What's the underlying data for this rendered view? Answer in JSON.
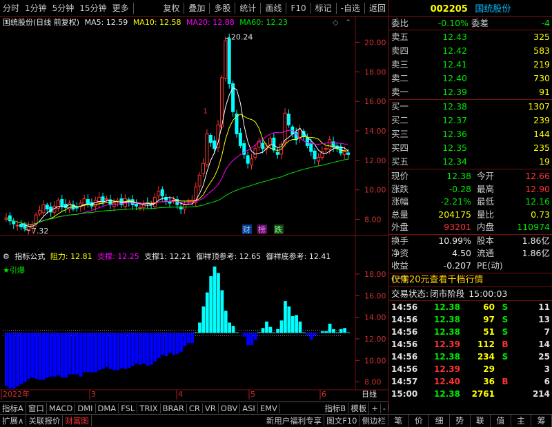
{
  "toolbar": {
    "left_items": [
      "分时",
      "1分钟",
      "5分钟",
      "15分钟",
      "更多"
    ],
    "right_items": [
      "复权",
      "叠加",
      "多股",
      "统计",
      "画线",
      "F10",
      "标记",
      "-自选",
      "返回"
    ]
  },
  "stock": {
    "code": "002205",
    "name": "国统股份"
  },
  "kline_header": {
    "title": "国统股份(日线 前复权)",
    "ma5_label": "MA5: 12.59",
    "ma10_label": "MA10: 12.58",
    "ma20_label": "MA20: 12.88",
    "ma60_label": "MA60: 12.23"
  },
  "kline_annotations": {
    "high": "20.24",
    "low": "7.32",
    "badge1": "财",
    "badge2": "榜",
    "badge3": "跌",
    "mark1": "1"
  },
  "price_axis": [
    "20.00",
    "18.00",
    "16.00",
    "14.00",
    "12.00",
    "10.00",
    "8.00"
  ],
  "indicator_header": {
    "title": "指标公式",
    "resist": "阻力: 12.81",
    "support": "支撑: 12.25",
    "support1": "支撑1: 12.21",
    "top_ref": "御祥顶参考: 12.65",
    "bottom_ref": "御祥底参考: 12.41",
    "signal": "★引爆"
  },
  "indicator_axis": [
    "18.00",
    "16.00",
    "14.00",
    "12.00",
    "10.00",
    "8.00"
  ],
  "time_axis": {
    "start": "2022年",
    "m3": "3",
    "m4": "4",
    "m5": "5",
    "m6": "6",
    "period": "日线"
  },
  "chart_data": [
    {
      "type": "candlestick",
      "title": "国统股份(日线 前复权)",
      "ylim": [
        7,
        21
      ],
      "annotations": {
        "high": 20.24,
        "low": 7.32
      },
      "close": [
        8.1,
        7.9,
        7.7,
        7.6,
        7.5,
        7.4,
        7.5,
        7.6,
        8.3,
        8.6,
        9.0,
        8.7,
        8.5,
        8.9,
        9.3,
        8.9,
        8.8,
        9.1,
        8.7,
        8.8,
        9.1,
        9.4,
        9.0,
        8.9,
        9.3,
        9.5,
        9.2,
        9.4,
        9.0,
        9.1,
        9.3,
        9.0,
        9.4,
        9.2,
        9.0,
        8.9,
        8.8,
        9.0,
        9.1,
        9.0,
        9.5,
        9.9,
        9.6,
        9.3,
        9.1,
        9.3,
        9.0,
        8.7,
        9.0,
        9.2,
        9.3,
        10.2,
        11.0,
        11.8,
        13.8,
        13.2,
        12.8,
        14.4,
        17.6,
        20.1,
        17.2,
        15.3,
        13.8,
        13.0,
        12.4,
        11.8,
        12.1,
        12.8,
        13.3,
        12.8,
        12.9,
        13.5,
        12.7,
        12.4,
        13.1,
        15.2,
        14.4,
        13.8,
        13.4,
        14.1,
        13.6,
        13.0,
        12.6,
        12.1,
        12.2,
        12.6,
        12.8,
        13.4,
        12.9,
        12.8,
        12.5,
        12.6,
        12.4
      ],
      "ma": {
        "MA5": 12.59,
        "MA10": 12.58,
        "MA20": 12.88,
        "MA60": 12.23
      }
    },
    {
      "type": "bar",
      "title": "指标公式",
      "ylim": [
        7.4,
        19.4
      ],
      "baseline": 12.55,
      "values": [
        7.6,
        7.4,
        7.4,
        7.6,
        7.8,
        8.0,
        8.3,
        8.4,
        8.3,
        8.2,
        8.2,
        8.4,
        8.5,
        8.5,
        8.6,
        8.4,
        8.4,
        8.7,
        8.7,
        8.7,
        8.5,
        8.9,
        8.9,
        8.9,
        8.9,
        9.1,
        9.2,
        9.4,
        9.2,
        9.1,
        9.1,
        9.3,
        9.2,
        9.3,
        9.5,
        9.7,
        9.6,
        9.7,
        9.5,
        9.6,
        9.9,
        10.2,
        10.5,
        10.4,
        10.7,
        10.5,
        10.6,
        10.8,
        11.3,
        11.6,
        11.6,
        12.6,
        13.5,
        15.0,
        16.3,
        17.8,
        18.7,
        18.1,
        16.5,
        14.6,
        13.5,
        13.2,
        12.6,
        12.5,
        12.2,
        11.4,
        11.4,
        11.9,
        12.6,
        13.0,
        13.6,
        13.1,
        12.6,
        12.9,
        13.7,
        15.5,
        15.0,
        14.1,
        14.2,
        13.6,
        12.6,
        12.3,
        11.9,
        12.3,
        12.5,
        12.7,
        12.7,
        13.4,
        12.9,
        12.6,
        12.9,
        13.0,
        12.6
      ]
    }
  ],
  "quotes": {
    "ratio_label": "委比",
    "ratio": "-0.10%",
    "diff_label": "委差",
    "diff": "-4",
    "asks": [
      {
        "label": "卖五",
        "price": "12.43",
        "vol": "325"
      },
      {
        "label": "卖四",
        "price": "12.42",
        "vol": "583"
      },
      {
        "label": "卖三",
        "price": "12.41",
        "vol": "219"
      },
      {
        "label": "卖二",
        "price": "12.40",
        "vol": "730"
      },
      {
        "label": "卖一",
        "price": "12.39",
        "vol": "91"
      }
    ],
    "bids": [
      {
        "label": "买一",
        "price": "12.38",
        "vol": "1307"
      },
      {
        "label": "买二",
        "price": "12.37",
        "vol": "239"
      },
      {
        "label": "买三",
        "price": "12.36",
        "vol": "144"
      },
      {
        "label": "买四",
        "price": "12.35",
        "vol": "235"
      },
      {
        "label": "买五",
        "price": "12.34",
        "vol": "19"
      }
    ]
  },
  "stats": [
    {
      "k1": "现价",
      "v1": "12.38",
      "k2": "今开",
      "v2": "12.66"
    },
    {
      "k1": "涨跌",
      "v1": "-0.28",
      "k2": "最高",
      "v2": "12.90"
    },
    {
      "k1": "涨幅",
      "v1": "-2.21%",
      "k2": "最低",
      "v2": "12.16"
    },
    {
      "k1": "总量",
      "v1": "204175",
      "k2": "量比",
      "v2": "0.73"
    },
    {
      "k1": "外盘",
      "v1": "93201",
      "k2": "内盘",
      "v2": "110974"
    },
    {
      "k1": "换手",
      "v1": "10.99%",
      "k2": "股本",
      "v2": "1.86亿"
    },
    {
      "k1": "净资",
      "v1": "4.50",
      "k2": "流通",
      "v2": "1.86亿"
    },
    {
      "k1": "收益(一)",
      "v1": "-0.207",
      "k2": "PE(动)",
      "v2": ""
    }
  ],
  "ad_text": "仅需20元查看千档行情",
  "trade_status": {
    "label": "交易状态:",
    "state": "闭市阶段",
    "time": "15:00:03"
  },
  "ticks": [
    {
      "t": "14:56",
      "p": "12.38",
      "v": "60",
      "d": "S",
      "n": "11"
    },
    {
      "t": "14:56",
      "p": "12.38",
      "v": "97",
      "d": "S",
      "n": "13"
    },
    {
      "t": "14:56",
      "p": "12.38",
      "v": "51",
      "d": "S",
      "n": "7"
    },
    {
      "t": "14:56",
      "p": "12.39",
      "v": "112",
      "d": "B",
      "n": "14"
    },
    {
      "t": "14:56",
      "p": "12.38",
      "v": "234",
      "d": "S",
      "n": "25"
    },
    {
      "t": "14:56",
      "p": "12.39",
      "v": "29",
      "d": "",
      "n": "3"
    },
    {
      "t": "14:57",
      "p": "12.40",
      "v": "36",
      "d": "B",
      "n": "6"
    },
    {
      "t": "15:00",
      "p": "12.38",
      "v": "2761",
      "d": "",
      "n": "214"
    }
  ],
  "indicator_tabs": [
    "指标A",
    "窗口",
    "MACD",
    "DMI",
    "DMA",
    "FSL",
    "TRIX",
    "BRAR",
    "CR",
    "VR",
    "OBV",
    "ASI",
    "EMV",
    "指标B",
    "模板",
    "+",
    "-"
  ],
  "bottom_tabs": [
    "扩展∧",
    "关联报价",
    "财富图"
  ],
  "bottom_right_links": [
    "新用户福利专享",
    "图文F10",
    "侧边栏"
  ],
  "panel_tabs": [
    "笔",
    "价",
    "细",
    "势",
    "联",
    "值",
    "主",
    "筹"
  ]
}
